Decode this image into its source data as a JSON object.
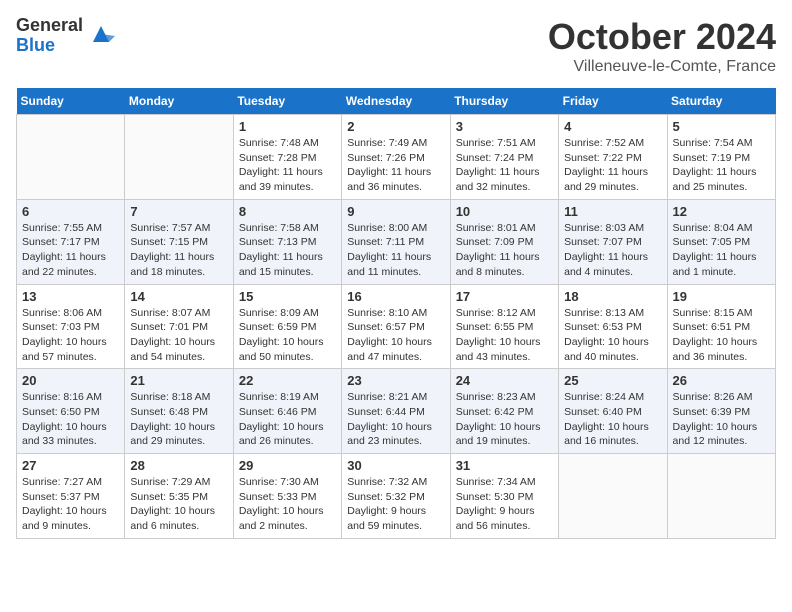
{
  "header": {
    "logo_general": "General",
    "logo_blue": "Blue",
    "month_title": "October 2024",
    "subtitle": "Villeneuve-le-Comte, France"
  },
  "weekdays": [
    "Sunday",
    "Monday",
    "Tuesday",
    "Wednesday",
    "Thursday",
    "Friday",
    "Saturday"
  ],
  "weeks": [
    [
      {
        "day": "",
        "sunrise": "",
        "sunset": "",
        "daylight": ""
      },
      {
        "day": "",
        "sunrise": "",
        "sunset": "",
        "daylight": ""
      },
      {
        "day": "1",
        "sunrise": "Sunrise: 7:48 AM",
        "sunset": "Sunset: 7:28 PM",
        "daylight": "Daylight: 11 hours and 39 minutes."
      },
      {
        "day": "2",
        "sunrise": "Sunrise: 7:49 AM",
        "sunset": "Sunset: 7:26 PM",
        "daylight": "Daylight: 11 hours and 36 minutes."
      },
      {
        "day": "3",
        "sunrise": "Sunrise: 7:51 AM",
        "sunset": "Sunset: 7:24 PM",
        "daylight": "Daylight: 11 hours and 32 minutes."
      },
      {
        "day": "4",
        "sunrise": "Sunrise: 7:52 AM",
        "sunset": "Sunset: 7:22 PM",
        "daylight": "Daylight: 11 hours and 29 minutes."
      },
      {
        "day": "5",
        "sunrise": "Sunrise: 7:54 AM",
        "sunset": "Sunset: 7:19 PM",
        "daylight": "Daylight: 11 hours and 25 minutes."
      }
    ],
    [
      {
        "day": "6",
        "sunrise": "Sunrise: 7:55 AM",
        "sunset": "Sunset: 7:17 PM",
        "daylight": "Daylight: 11 hours and 22 minutes."
      },
      {
        "day": "7",
        "sunrise": "Sunrise: 7:57 AM",
        "sunset": "Sunset: 7:15 PM",
        "daylight": "Daylight: 11 hours and 18 minutes."
      },
      {
        "day": "8",
        "sunrise": "Sunrise: 7:58 AM",
        "sunset": "Sunset: 7:13 PM",
        "daylight": "Daylight: 11 hours and 15 minutes."
      },
      {
        "day": "9",
        "sunrise": "Sunrise: 8:00 AM",
        "sunset": "Sunset: 7:11 PM",
        "daylight": "Daylight: 11 hours and 11 minutes."
      },
      {
        "day": "10",
        "sunrise": "Sunrise: 8:01 AM",
        "sunset": "Sunset: 7:09 PM",
        "daylight": "Daylight: 11 hours and 8 minutes."
      },
      {
        "day": "11",
        "sunrise": "Sunrise: 8:03 AM",
        "sunset": "Sunset: 7:07 PM",
        "daylight": "Daylight: 11 hours and 4 minutes."
      },
      {
        "day": "12",
        "sunrise": "Sunrise: 8:04 AM",
        "sunset": "Sunset: 7:05 PM",
        "daylight": "Daylight: 11 hours and 1 minute."
      }
    ],
    [
      {
        "day": "13",
        "sunrise": "Sunrise: 8:06 AM",
        "sunset": "Sunset: 7:03 PM",
        "daylight": "Daylight: 10 hours and 57 minutes."
      },
      {
        "day": "14",
        "sunrise": "Sunrise: 8:07 AM",
        "sunset": "Sunset: 7:01 PM",
        "daylight": "Daylight: 10 hours and 54 minutes."
      },
      {
        "day": "15",
        "sunrise": "Sunrise: 8:09 AM",
        "sunset": "Sunset: 6:59 PM",
        "daylight": "Daylight: 10 hours and 50 minutes."
      },
      {
        "day": "16",
        "sunrise": "Sunrise: 8:10 AM",
        "sunset": "Sunset: 6:57 PM",
        "daylight": "Daylight: 10 hours and 47 minutes."
      },
      {
        "day": "17",
        "sunrise": "Sunrise: 8:12 AM",
        "sunset": "Sunset: 6:55 PM",
        "daylight": "Daylight: 10 hours and 43 minutes."
      },
      {
        "day": "18",
        "sunrise": "Sunrise: 8:13 AM",
        "sunset": "Sunset: 6:53 PM",
        "daylight": "Daylight: 10 hours and 40 minutes."
      },
      {
        "day": "19",
        "sunrise": "Sunrise: 8:15 AM",
        "sunset": "Sunset: 6:51 PM",
        "daylight": "Daylight: 10 hours and 36 minutes."
      }
    ],
    [
      {
        "day": "20",
        "sunrise": "Sunrise: 8:16 AM",
        "sunset": "Sunset: 6:50 PM",
        "daylight": "Daylight: 10 hours and 33 minutes."
      },
      {
        "day": "21",
        "sunrise": "Sunrise: 8:18 AM",
        "sunset": "Sunset: 6:48 PM",
        "daylight": "Daylight: 10 hours and 29 minutes."
      },
      {
        "day": "22",
        "sunrise": "Sunrise: 8:19 AM",
        "sunset": "Sunset: 6:46 PM",
        "daylight": "Daylight: 10 hours and 26 minutes."
      },
      {
        "day": "23",
        "sunrise": "Sunrise: 8:21 AM",
        "sunset": "Sunset: 6:44 PM",
        "daylight": "Daylight: 10 hours and 23 minutes."
      },
      {
        "day": "24",
        "sunrise": "Sunrise: 8:23 AM",
        "sunset": "Sunset: 6:42 PM",
        "daylight": "Daylight: 10 hours and 19 minutes."
      },
      {
        "day": "25",
        "sunrise": "Sunrise: 8:24 AM",
        "sunset": "Sunset: 6:40 PM",
        "daylight": "Daylight: 10 hours and 16 minutes."
      },
      {
        "day": "26",
        "sunrise": "Sunrise: 8:26 AM",
        "sunset": "Sunset: 6:39 PM",
        "daylight": "Daylight: 10 hours and 12 minutes."
      }
    ],
    [
      {
        "day": "27",
        "sunrise": "Sunrise: 7:27 AM",
        "sunset": "Sunset: 5:37 PM",
        "daylight": "Daylight: 10 hours and 9 minutes."
      },
      {
        "day": "28",
        "sunrise": "Sunrise: 7:29 AM",
        "sunset": "Sunset: 5:35 PM",
        "daylight": "Daylight: 10 hours and 6 minutes."
      },
      {
        "day": "29",
        "sunrise": "Sunrise: 7:30 AM",
        "sunset": "Sunset: 5:33 PM",
        "daylight": "Daylight: 10 hours and 2 minutes."
      },
      {
        "day": "30",
        "sunrise": "Sunrise: 7:32 AM",
        "sunset": "Sunset: 5:32 PM",
        "daylight": "Daylight: 9 hours and 59 minutes."
      },
      {
        "day": "31",
        "sunrise": "Sunrise: 7:34 AM",
        "sunset": "Sunset: 5:30 PM",
        "daylight": "Daylight: 9 hours and 56 minutes."
      },
      {
        "day": "",
        "sunrise": "",
        "sunset": "",
        "daylight": ""
      },
      {
        "day": "",
        "sunrise": "",
        "sunset": "",
        "daylight": ""
      }
    ]
  ]
}
